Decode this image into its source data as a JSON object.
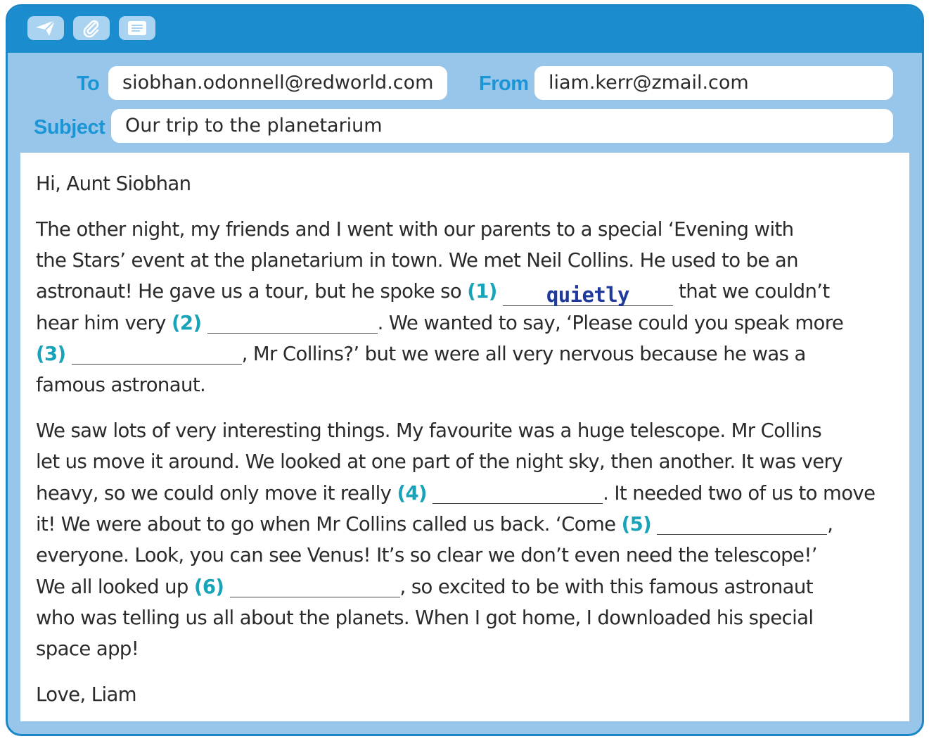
{
  "toolbar": {
    "buttons": [
      {
        "icon": "send-icon"
      },
      {
        "icon": "paperclip-icon"
      },
      {
        "icon": "notes-icon"
      }
    ]
  },
  "email": {
    "to_label": "To",
    "to_value": "siobhan.odonnell@redworld.com",
    "from_label": "From",
    "from_value": "liam.kerr@zmail.com",
    "subject_label": "Subject",
    "subject_value": "Our trip to the planetarium"
  },
  "body": {
    "greeting": "Hi, Aunt Siobhan",
    "p1": {
      "l1": "The other night, my friends and I went with our parents to a special ‘Evening with",
      "l2": "the Stars’ event at the planetarium in town. We met Neil Collins. He used to be an",
      "l3a": "astronaut! He gave us a tour, but he spoke so ",
      "n1": "(1)",
      "a1": "quietly",
      "l3b": " that we couldn’t",
      "l4a": "hear him very ",
      "n2": "(2)",
      "l4b": ". We wanted to say, ‘Please could you speak more",
      "n3": "(3)",
      "l5b": ", Mr Collins?’ but we were all very nervous because he was a",
      "l6": "famous astronaut."
    },
    "p2": {
      "l1": "We saw lots of very interesting things. My favourite was a huge telescope. Mr Collins",
      "l2": "let us move it around. We looked at one part of the night sky, then another. It was very",
      "l3a": "heavy, so we could only move it really ",
      "n4": "(4)",
      "l3b": ". It needed two of us to move",
      "l4a": "it! We were about to go when Mr Collins called us back. ‘Come ",
      "n5": "(5)",
      "l4b": ",",
      "l5": "everyone. Look, you can see Venus! It’s so clear we don’t even need the telescope!’",
      "l6a": "We all looked up ",
      "n6": "(6)",
      "l6b": ", so excited to be with this famous astronaut",
      "l7": "who was telling us all about the planets. When I got home, I downloaded his special",
      "l8": "space app!"
    },
    "signoff": "Love, Liam"
  },
  "colors": {
    "toolbar": "#1b8ccd",
    "header_bg": "#98c6ea",
    "label": "#1a95d6",
    "number": "#19a3b8",
    "answer": "#1f3a9b"
  }
}
